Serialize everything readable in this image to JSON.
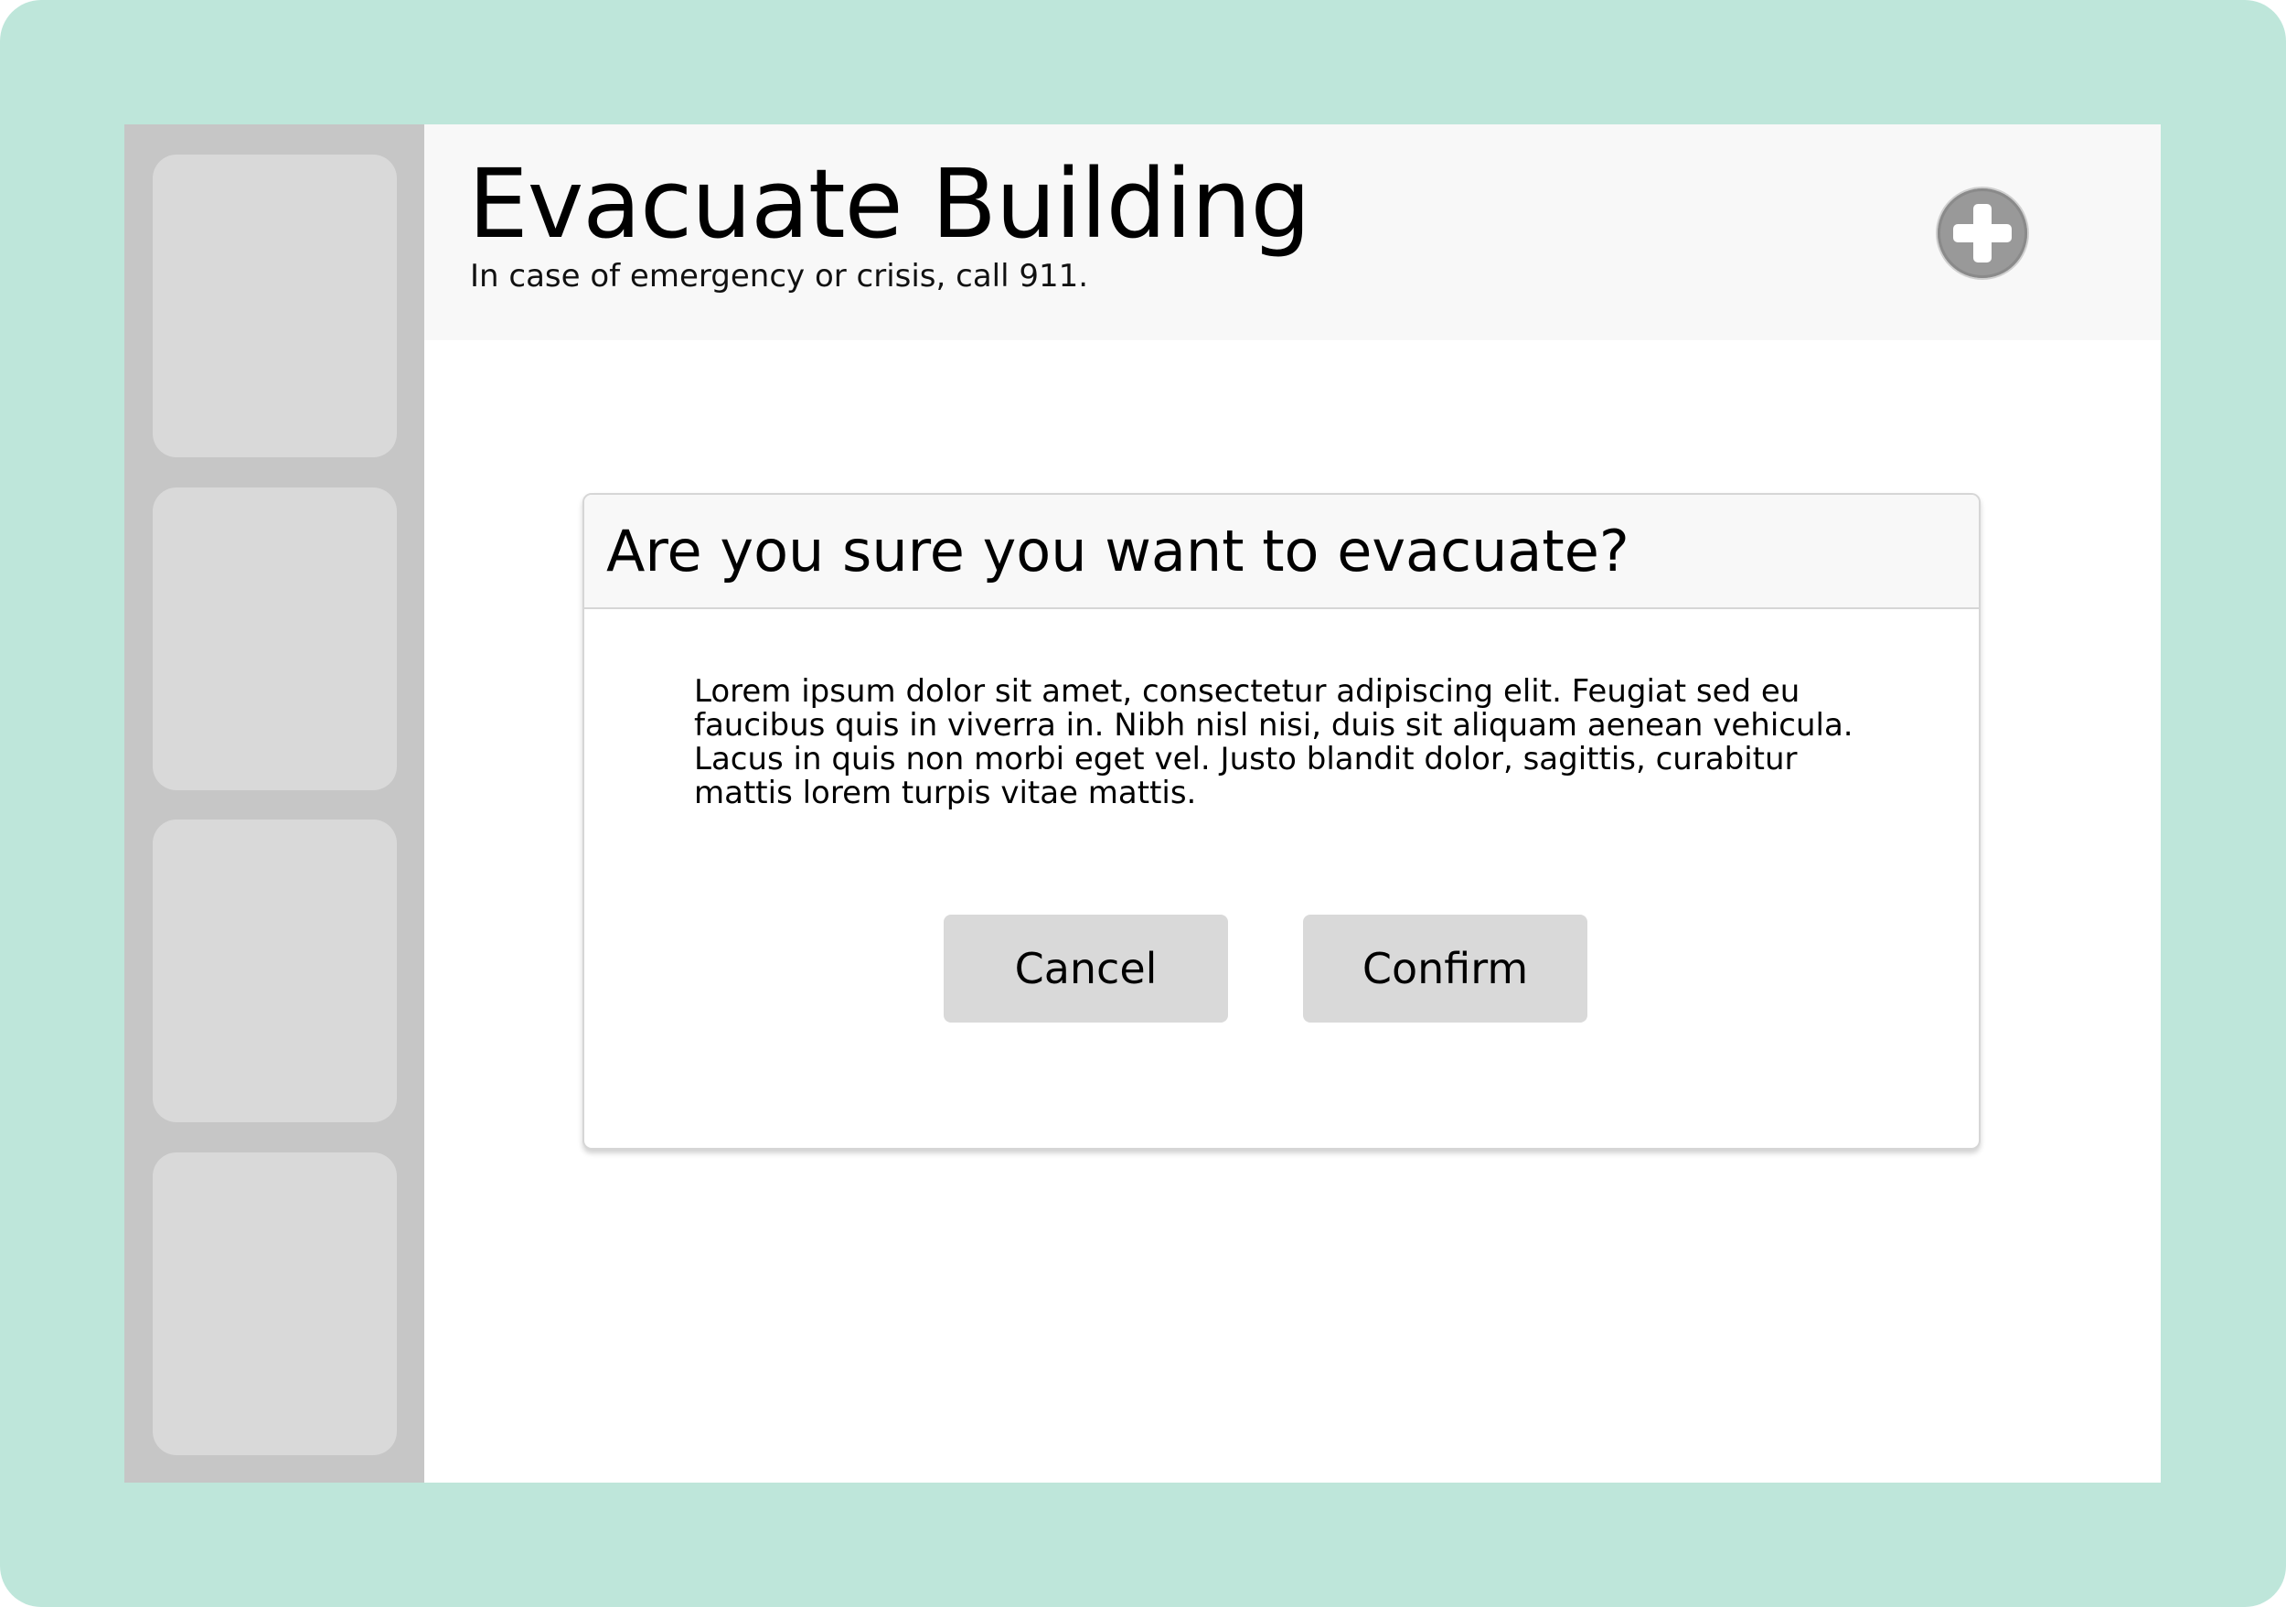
{
  "colors": {
    "device_frame": "#bee6da",
    "sidebar": "#c6c6c6",
    "sidebar_tile": "#d9d9d9",
    "header_background": "#f8f8f8",
    "button_background": "#d9d9d9",
    "add_button": "#999999"
  },
  "sidebar": {
    "items": [
      {
        "icon": "blank-tile"
      },
      {
        "icon": "blank-tile"
      },
      {
        "icon": "blank-tile"
      },
      {
        "icon": "blank-tile"
      }
    ]
  },
  "header": {
    "title": "Evacuate Building",
    "subtitle": "In case of emergency or crisis, call 911.",
    "action_icon": "plus-icon"
  },
  "dialog": {
    "title": "Are you sure you want to evacuate?",
    "body": "Lorem ipsum dolor sit amet, consectetur adipiscing elit. Feugiat sed eu faucibus quis in viverra in. Nibh nisl nisi, duis sit aliquam aenean vehicula. Lacus in quis non morbi eget vel. Justo blandit dolor, sagittis, curabitur mattis lorem turpis vitae mattis.",
    "cancel_label": "Cancel",
    "confirm_label": "Confirm"
  }
}
